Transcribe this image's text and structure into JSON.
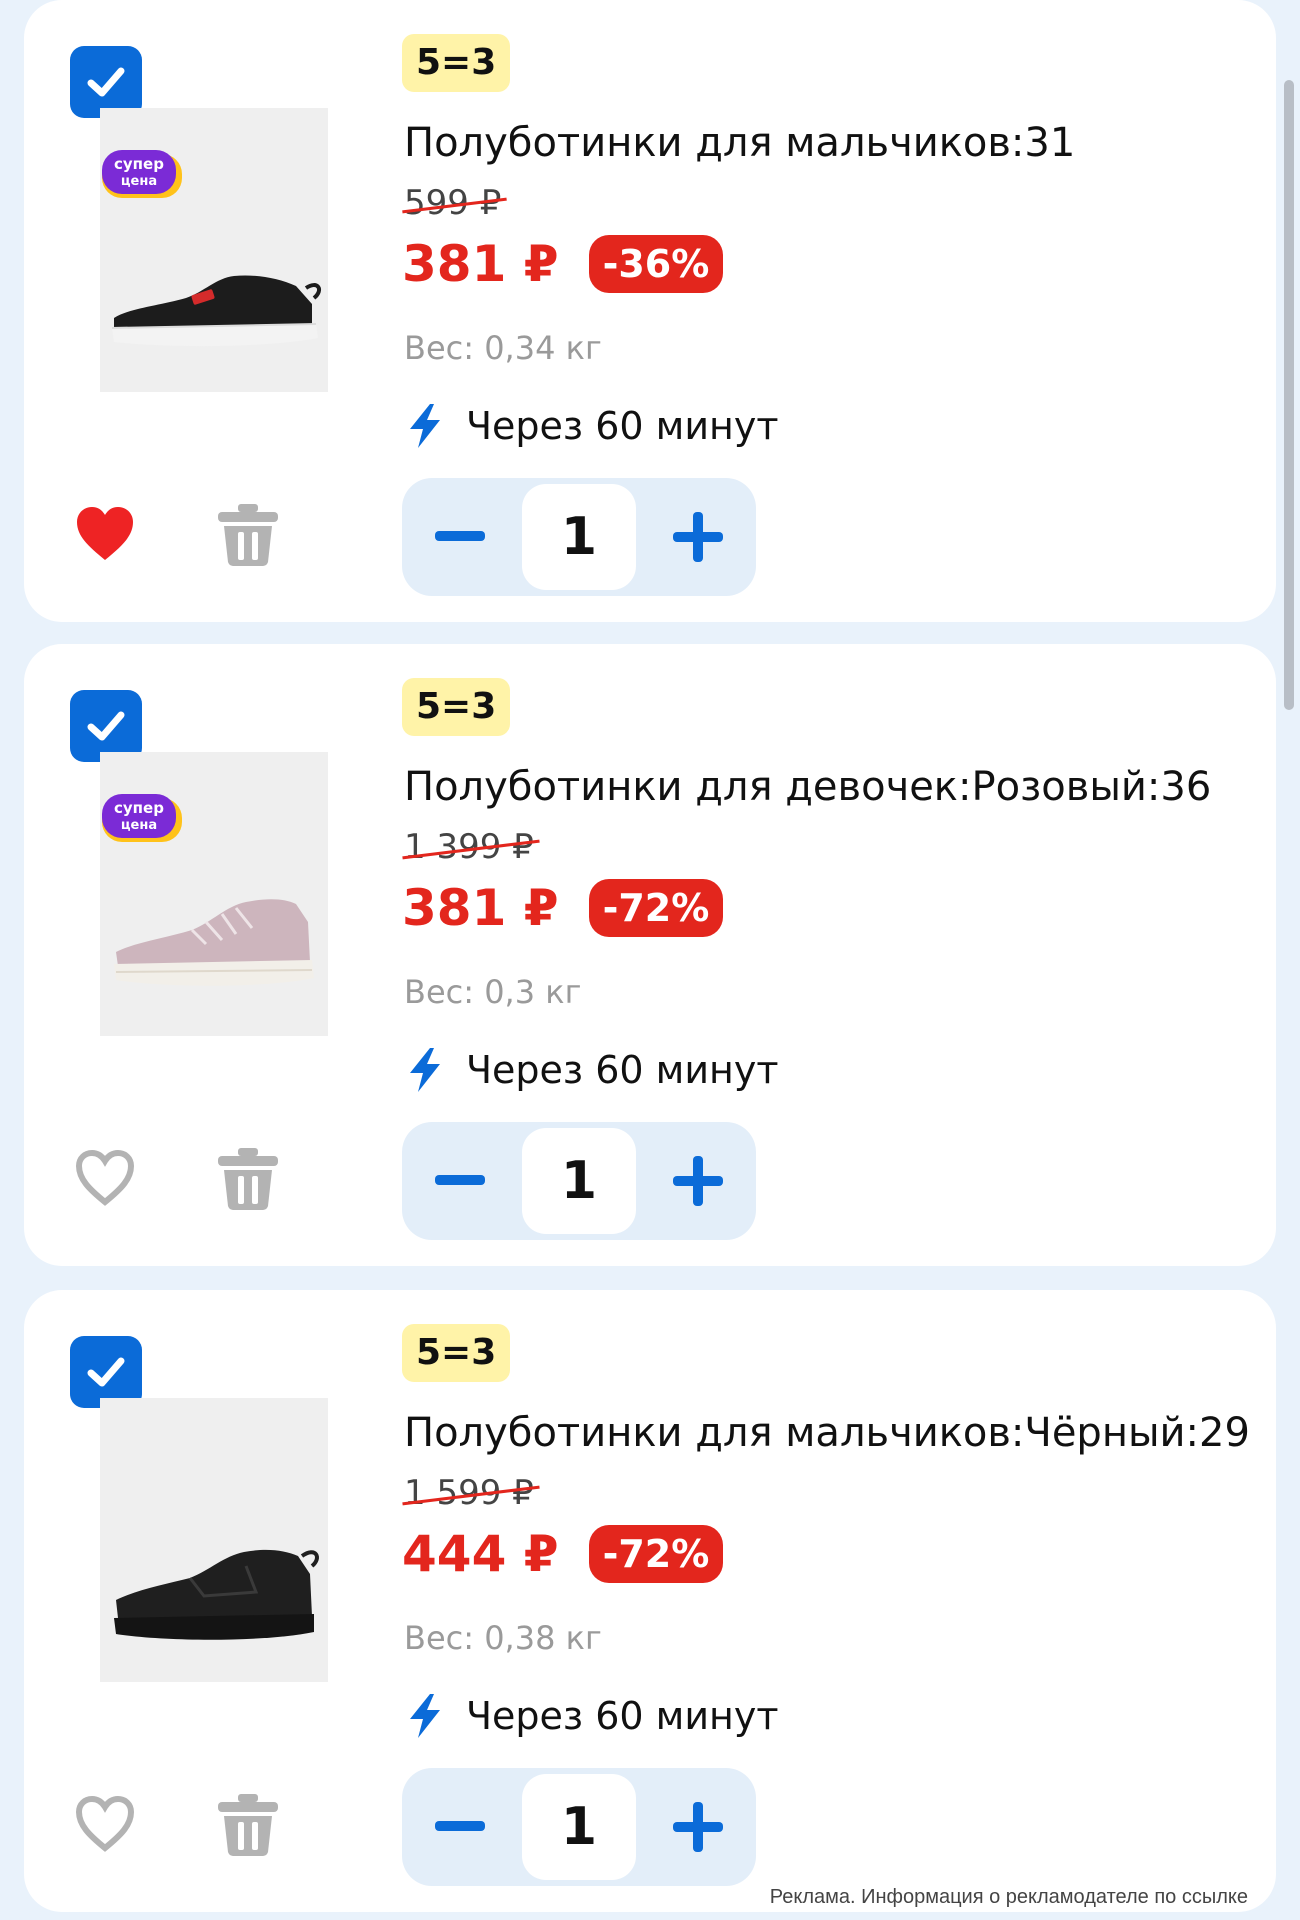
{
  "colors": {
    "accent": "#0b6bd8",
    "price_red": "#e3261d",
    "promo_yellow": "#fff3a8",
    "background": "#e9f2fb"
  },
  "icons": {
    "checkbox": "check-icon",
    "favorite": "heart-icon",
    "delete": "trash-icon",
    "delivery": "lightning-icon",
    "decrease": "minus-icon",
    "increase": "plus-icon"
  },
  "items": [
    {
      "selected": true,
      "promo": "5=3",
      "super_badge": [
        "супер",
        "цена"
      ],
      "title": "Полуботинки для мальчиков:31",
      "old_price": "599 ₽",
      "price": "381 ₽",
      "discount": "-36%",
      "weight": "Вес: 0,34 кг",
      "delivery": "Через 60 минут",
      "favorite": true,
      "quantity": "1",
      "shoe_color": "black-white"
    },
    {
      "selected": true,
      "promo": "5=3",
      "super_badge": [
        "супер",
        "цена"
      ],
      "title": "Полуботинки для девочек:Розовый:36",
      "old_price": "1 399 ₽",
      "price": "381 ₽",
      "discount": "-72%",
      "weight": "Вес: 0,3 кг",
      "delivery": "Через 60 минут",
      "favorite": false,
      "quantity": "1",
      "shoe_color": "pink"
    },
    {
      "selected": true,
      "promo": "5=3",
      "super_badge": [],
      "title": "Полуботинки для мальчиков:Чёрный:29",
      "old_price": "1 599 ₽",
      "price": "444 ₽",
      "discount": "-72%",
      "weight": "Вес: 0,38 кг",
      "delivery": "Через 60 минут",
      "favorite": false,
      "quantity": "1",
      "shoe_color": "all-black"
    }
  ],
  "footer": {
    "ad_note": "Реклама. Информация о рекламодателе по ссылке"
  }
}
